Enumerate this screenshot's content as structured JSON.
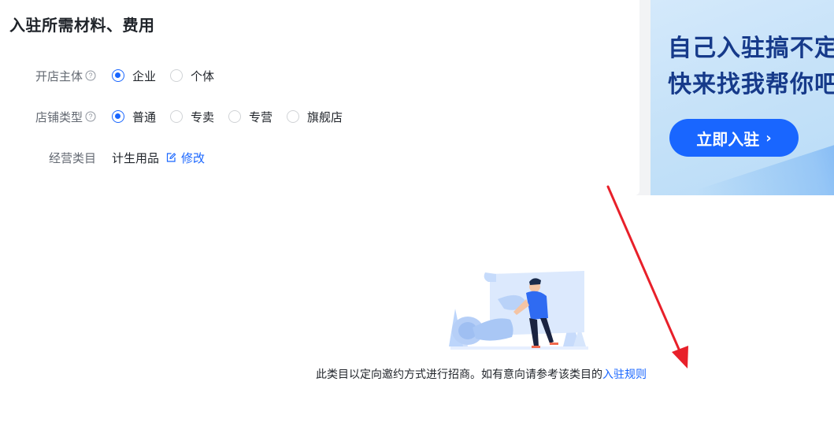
{
  "card": {
    "title": "入驻所需材料、费用",
    "store_entity": {
      "label": "开店主体",
      "options": [
        {
          "label": "企业",
          "checked": true
        },
        {
          "label": "个体",
          "checked": false
        }
      ]
    },
    "store_type": {
      "label": "店铺类型",
      "options": [
        {
          "label": "普通",
          "checked": true
        },
        {
          "label": "专卖",
          "checked": false
        },
        {
          "label": "专营",
          "checked": false
        },
        {
          "label": "旗舰店",
          "checked": false
        }
      ]
    },
    "business_category": {
      "label": "经营类目",
      "value": "计生用品",
      "edit_label": "修改"
    }
  },
  "banner": {
    "line1": "自己入驻搞不定",
    "line2": "快来找我帮你吧",
    "cta_label": "立即入驻",
    "cta_chevron": "›"
  },
  "notice": {
    "text": "此类目以定向邀约方式进行招商。如有意向请参考该类目的",
    "link_label": "入驻规则"
  },
  "colors": {
    "accent": "#1966ff",
    "annotation_arrow": "#e8202a"
  },
  "icons": [
    "help-icon",
    "edit-icon",
    "chevron-right-icon",
    "empty-state-illustration"
  ]
}
